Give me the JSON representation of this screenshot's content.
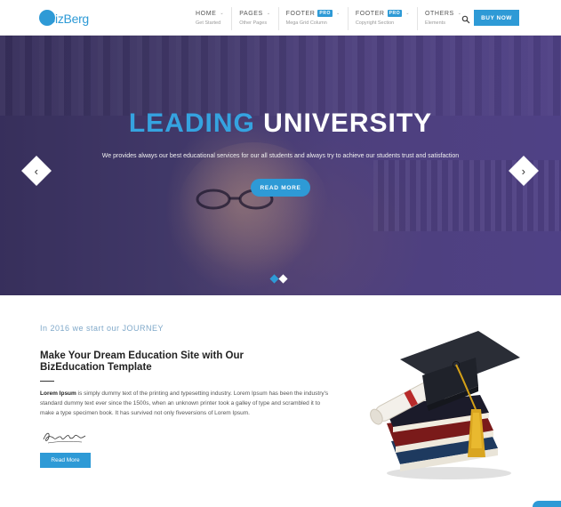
{
  "header": {
    "logo_text": "BizBerg",
    "nav": [
      {
        "label": "HOME",
        "sub": "Get Started",
        "pro": "",
        "caret": "⌄"
      },
      {
        "label": "PAGES",
        "sub": "Other Pages",
        "pro": "",
        "caret": "⌄"
      },
      {
        "label": "FOOTER",
        "sub": "Mega Grid Column",
        "pro": "PRO",
        "caret": "⌄"
      },
      {
        "label": "FOOTER",
        "sub": "Copyright Section",
        "pro": "PRO",
        "caret": "⌄"
      },
      {
        "label": "OTHERS",
        "sub": "Elements",
        "pro": "",
        "caret": "⌄"
      }
    ],
    "buy_label": "BUY NOW"
  },
  "hero": {
    "title_part1": "LEADING",
    "title_part2": "UNIVERSITY",
    "subtitle": "We provides always our best educational services for our all students and always try to achieve our students trust and satisfaction",
    "button_label": "READ MORE",
    "prev_icon": "‹",
    "next_icon": "›",
    "active_slide": 1,
    "slide_count": 2
  },
  "about": {
    "eyebrow": "In 2016 we start our JOURNEY",
    "title": "Make Your Dream Education Site with Our BizEducation Template",
    "para_lead": "Lorem Ipsum",
    "para_body": " is simply dummy text of the printing and typesetting industry. Lorem Ipsum has been the industry's standard dummy text ever since the 1500s, when an unknown printer took a galley of type and scrambled it to make a type specimen book. It has survived not only fiveversions of Lorem Ipsum.",
    "button_label": "Read More"
  },
  "colors": {
    "accent": "#2e9ad6",
    "title_accent": "#35a3e0",
    "eyebrow": "#7fa8c9"
  }
}
